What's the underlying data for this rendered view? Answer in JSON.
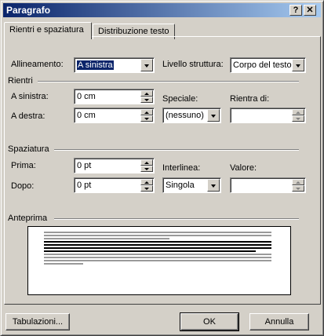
{
  "window": {
    "title": "Paragrafo",
    "help_glyph": "?",
    "close_glyph": "✕"
  },
  "tabs": [
    {
      "label": "Rientri e spaziatura",
      "active": true
    },
    {
      "label": "Distribuzione testo",
      "active": false
    }
  ],
  "general": {
    "alignment_label": "Allineamento:",
    "alignment_value": "A sinistra",
    "outline_label": "Livello struttura:",
    "outline_value": "Corpo del testo"
  },
  "indent": {
    "section_label": "Rientri",
    "left_label": "A sinistra:",
    "left_value": "0 cm",
    "right_label": "A destra:",
    "right_value": "0 cm",
    "special_label": "Speciale:",
    "special_value": "(nessuno)",
    "by_label": "Rientra di:",
    "by_value": ""
  },
  "spacing": {
    "section_label": "Spaziatura",
    "before_label": "Prima:",
    "before_value": "0 pt",
    "after_label": "Dopo:",
    "after_value": "0 pt",
    "line_label": "Interlinea:",
    "line_value": "Singola",
    "at_label": "Valore:",
    "at_value": ""
  },
  "preview": {
    "section_label": "Anteprima",
    "prev_paragraph_color": "#9a9a9a",
    "sample_text_color": "#000000",
    "next_paragraph_color": "#9a9a9a"
  },
  "buttons": {
    "tabs_label": "Tabulazioni...",
    "ok_label": "OK",
    "cancel_label": "Annulla"
  },
  "colors": {
    "titlebar_start": "#0a246a",
    "titlebar_end": "#a6caf0",
    "face": "#d4d0c8"
  }
}
